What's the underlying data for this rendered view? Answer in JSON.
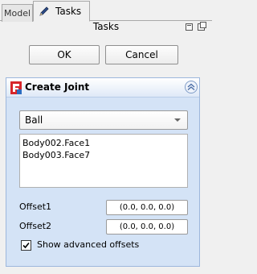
{
  "tabs": [
    {
      "label": "Model"
    },
    {
      "label": "Tasks"
    }
  ],
  "panel": {
    "title": "Tasks"
  },
  "buttons": {
    "ok": "OK",
    "cancel": "Cancel"
  },
  "taskbox": {
    "title": "Create Joint"
  },
  "joint_type": {
    "selected": "Ball"
  },
  "references": [
    "Body002.Face1",
    "Body003.Face7"
  ],
  "offsets": [
    {
      "label": "Offset1",
      "value": "(0.0, 0.0, 0.0)"
    },
    {
      "label": "Offset2",
      "value": "(0.0, 0.0, 0.0)"
    }
  ],
  "advanced": {
    "label": "Show advanced offsets",
    "checked": true
  },
  "colors": {
    "taskbox_bg": "#d4e3f6",
    "taskbox_border": "#9db7dc",
    "logo_red": "#d7262b",
    "logo_blue": "#2c6bbf"
  },
  "icons": [
    "pencil-icon",
    "float-icon",
    "close-icon",
    "freecad-logo-icon",
    "collapse-icon",
    "dropdown-arrow-icon",
    "checkmark-icon"
  ]
}
